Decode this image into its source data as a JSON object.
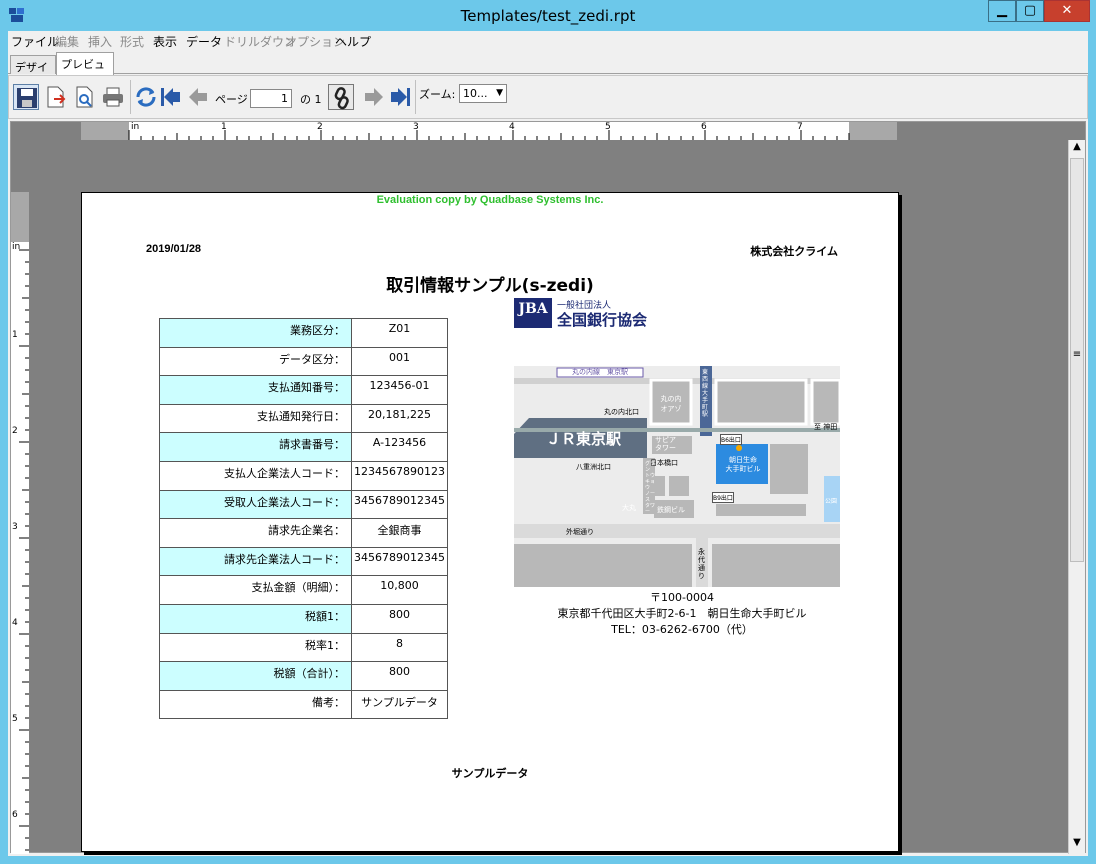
{
  "window": {
    "title": "Templates/test_zedi.rpt",
    "min_glyph": "▁",
    "max_glyph": "▢",
    "close_glyph": "✕"
  },
  "menu": [
    {
      "label": "ファイル",
      "enabled": true
    },
    {
      "label": "編集",
      "enabled": false
    },
    {
      "label": "挿入",
      "enabled": false
    },
    {
      "label": "形式",
      "enabled": false
    },
    {
      "label": "表示",
      "enabled": true
    },
    {
      "label": "データ",
      "enabled": true
    },
    {
      "label": "ドリルダウン",
      "enabled": false
    },
    {
      "label": "オプション",
      "enabled": false
    },
    {
      "label": "ヘルプ",
      "enabled": true
    }
  ],
  "tabs": [
    {
      "label": "デザイン",
      "active": false
    },
    {
      "label": "プレビュー",
      "active": true
    }
  ],
  "toolbar": {
    "page_label": "ページ",
    "page_value": "1",
    "page_of": "の 1",
    "zoom_label": "ズーム:",
    "zoom_value": "10...",
    "zoom_arrow": "▼"
  },
  "ruler": {
    "unit": "in",
    "h_numbers": [
      "1",
      "2",
      "3",
      "4",
      "5",
      "6",
      "7"
    ],
    "v_numbers": [
      "1",
      "2",
      "3",
      "4",
      "5",
      "6"
    ]
  },
  "scrollbar": {
    "up": "▲",
    "down": "▼",
    "grip": "≡"
  },
  "report": {
    "watermark": "Evaluation copy by Quadbase Systems Inc.",
    "date": "2019/01/28",
    "company": "株式会社クライム",
    "title": "取引情報サンプル(s-zedi)",
    "rows": [
      {
        "label": "業務区分：",
        "value": "Z01",
        "highlight": true
      },
      {
        "label": "データ区分：",
        "value": "001",
        "highlight": false
      },
      {
        "label": "支払通知番号：",
        "value": "123456-01",
        "highlight": true
      },
      {
        "label": "支払通知発行日：",
        "value": "20,181,225",
        "highlight": false
      },
      {
        "label": "請求書番号：",
        "value": "A-123456",
        "highlight": true
      },
      {
        "label": "支払人企業法人コード：",
        "value": "1234567890123",
        "highlight": false
      },
      {
        "label": "受取人企業法人コード：",
        "value": "3456789012345",
        "highlight": true
      },
      {
        "label": "請求先企業名：",
        "value": "全銀商事",
        "highlight": false
      },
      {
        "label": "請求先企業法人コード：",
        "value": "3456789012345",
        "highlight": true
      },
      {
        "label": "支払金額（明細）：",
        "value": "10,800",
        "highlight": false
      },
      {
        "label": "税額1：",
        "value": "800",
        "highlight": true
      },
      {
        "label": "税率1：",
        "value": "8",
        "highlight": false
      },
      {
        "label": "税額（合計）：",
        "value": "800",
        "highlight": true
      },
      {
        "label": "備考：",
        "value": "サンプルデータ",
        "highlight": false
      }
    ],
    "logo": {
      "mark": "JBA",
      "small_text": "一般社団法人",
      "name": "全国銀行協会"
    },
    "map_labels": {
      "line_top": "丸の内線　東京駅",
      "marunouchi_oazo": "丸の内\nオアゾ",
      "marunouchi_kitaguchi": "丸の内北口",
      "jr_tokyo": "ＪＲ東京駅",
      "sapia_tower": "サピア\nタワー",
      "nihonbashi_guchi": "日本橋口",
      "yaesu_kitaguchi": "八重洲北口",
      "b6_exit": "B6出口",
      "b9_exit": "B9出口",
      "building": "朝日生命\n大手町ビル",
      "tekkou_bldg": "鉄鋼ビル",
      "daimaru": "大丸",
      "gran_tokyo": "グラン\nトウキョウ\nノース\nタワー",
      "otemachi_station": "東西線\n大手町駅",
      "gaibori": "外堀通り",
      "eitai": "永代\n通り",
      "kanda": "至 神田",
      "park": "公園"
    },
    "address": {
      "zip": "〒100-0004",
      "line": "東京都千代田区大手町2-6-1　朝日生命大手町ビル",
      "tel": "TEL：03-6262-6700（代）"
    },
    "footer": "サンプルデータ"
  }
}
